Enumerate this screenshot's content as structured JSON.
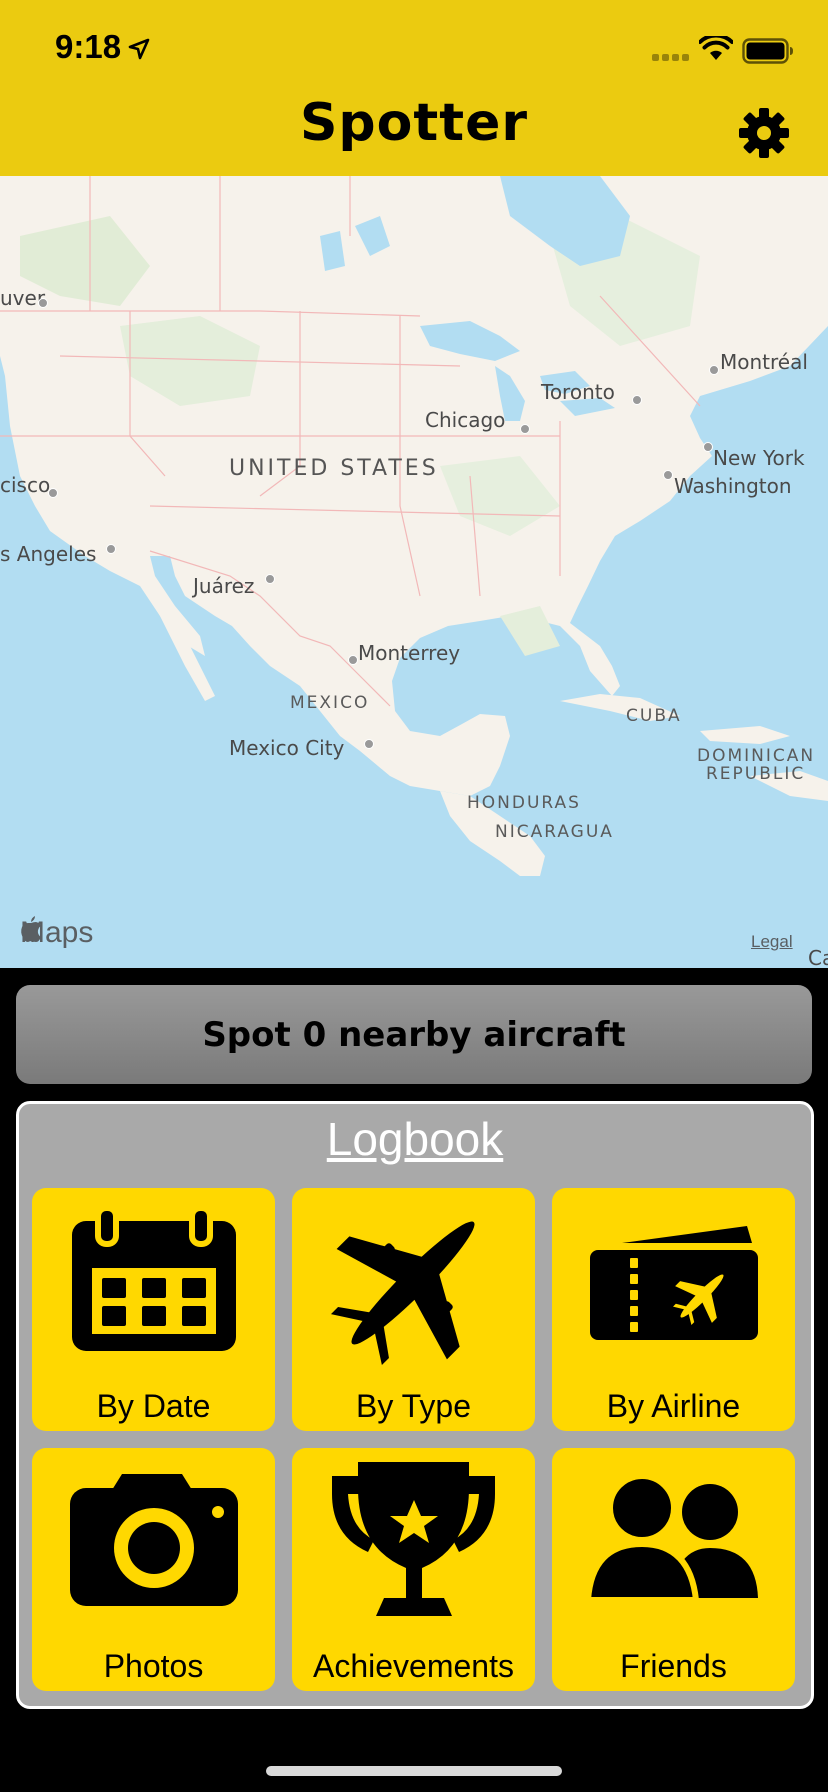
{
  "status_bar": {
    "time": "9:18",
    "icons": [
      "location-arrow-icon",
      "cellular-signal-icon",
      "wifi-icon",
      "battery-icon"
    ]
  },
  "header": {
    "title": "Spotter",
    "settings_icon": "gear-icon",
    "background_color": "#EBCB10"
  },
  "map": {
    "labels": {
      "vancouver": "uver",
      "francisco": "cisco",
      "los_angeles": "s Angeles",
      "juarez": "Juárez",
      "chicago": "Chicago",
      "toronto": "Toronto",
      "montreal": "Montréal",
      "new_york": "New York",
      "washington": "Washington",
      "monterrey": "Monterrey",
      "mexico_city": "Mexico City"
    },
    "countries": {
      "united_states": "UNITED STATES",
      "mexico": "MEXICO",
      "cuba": "CUBA",
      "dominican_republic_1": "DOMINICAN",
      "dominican_republic_2": "REPUBLIC",
      "honduras": "HONDURAS",
      "nicaragua": "NICARAGUA"
    },
    "attribution": "Maps",
    "legal": "Legal",
    "edge_label": "Ca"
  },
  "spot_button": {
    "label": "Spot 0 nearby aircraft"
  },
  "logbook": {
    "title": "Logbook",
    "tiles": [
      {
        "label": "By Date",
        "icon": "calendar-icon"
      },
      {
        "label": "By Type",
        "icon": "airplane-icon"
      },
      {
        "label": "By Airline",
        "icon": "ticket-icon"
      },
      {
        "label": "Photos",
        "icon": "camera-icon"
      },
      {
        "label": "Achievements",
        "icon": "trophy-icon"
      },
      {
        "label": "Friends",
        "icon": "friends-icon"
      }
    ],
    "tile_color": "#FFD800",
    "panel_color": "#A9A9A9"
  }
}
